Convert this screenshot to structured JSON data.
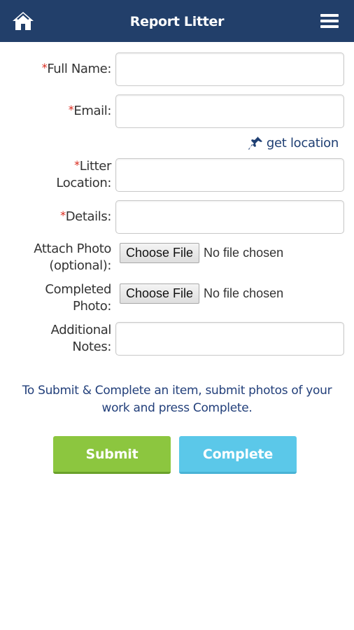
{
  "header": {
    "title": "Report Litter",
    "home_icon": "home-icon",
    "menu_icon": "hamburger-menu-icon",
    "background_color": "#223f6a"
  },
  "form": {
    "required_marker": "*",
    "full_name": {
      "label": "Full Name:",
      "value": ""
    },
    "email": {
      "label": "Email:",
      "value": ""
    },
    "get_location": {
      "label": "get location",
      "icon": "pushpin-icon"
    },
    "litter_location": {
      "label_line1": "Litter",
      "label_line2": "Location:",
      "value": ""
    },
    "details": {
      "label": "Details:",
      "value": ""
    },
    "attach_photo": {
      "label_line1": "Attach Photo",
      "label_line2": "(optional):",
      "button": "Choose File",
      "status": "No file chosen"
    },
    "completed_photo": {
      "label_line1": "Completed",
      "label_line2": "Photo:",
      "button": "Choose File",
      "status": "No file chosen"
    },
    "additional_notes": {
      "label_line1": "Additional",
      "label_line2": "Notes:",
      "value": ""
    }
  },
  "instructions": "To Submit & Complete an item, submit photos of your work and press Complete.",
  "actions": {
    "submit": "Submit",
    "complete": "Complete",
    "submit_color": "#8cc63f",
    "complete_color": "#5bc8e9"
  }
}
